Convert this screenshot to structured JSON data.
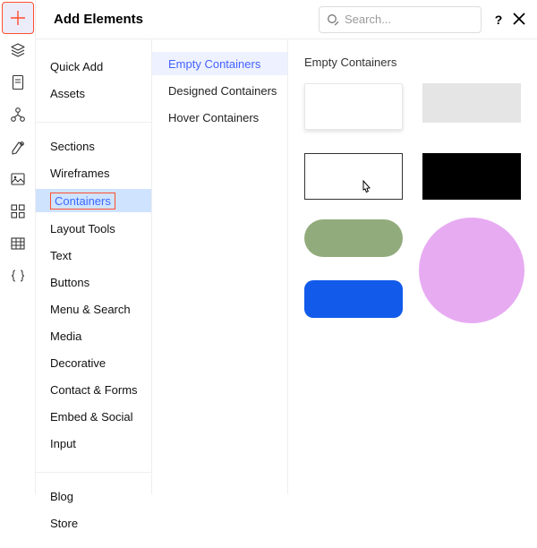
{
  "header": {
    "title": "Add Elements",
    "search_placeholder": "Search...",
    "help_label": "?"
  },
  "toolstrip": {
    "items": [
      {
        "name": "add-icon"
      },
      {
        "name": "layers-icon"
      },
      {
        "name": "pages-icon"
      },
      {
        "name": "site-structure-icon"
      },
      {
        "name": "style-icon"
      },
      {
        "name": "media-icon"
      },
      {
        "name": "apps-icon"
      },
      {
        "name": "grid-icon"
      },
      {
        "name": "code-icon"
      }
    ],
    "selected_index": 0
  },
  "categories": {
    "groups": [
      [
        "Quick Add",
        "Assets"
      ],
      [
        "Sections",
        "Wireframes",
        "Containers",
        "Layout Tools",
        "Text",
        "Buttons",
        "Menu & Search",
        "Media",
        "Decorative",
        "Contact & Forms",
        "Embed & Social",
        "Input"
      ],
      [
        "Blog",
        "Store"
      ]
    ],
    "selected": "Containers"
  },
  "subcategories": {
    "items": [
      "Empty Containers",
      "Designed Containers",
      "Hover Containers"
    ],
    "active": "Empty Containers"
  },
  "preview": {
    "title": "Empty Containers"
  }
}
